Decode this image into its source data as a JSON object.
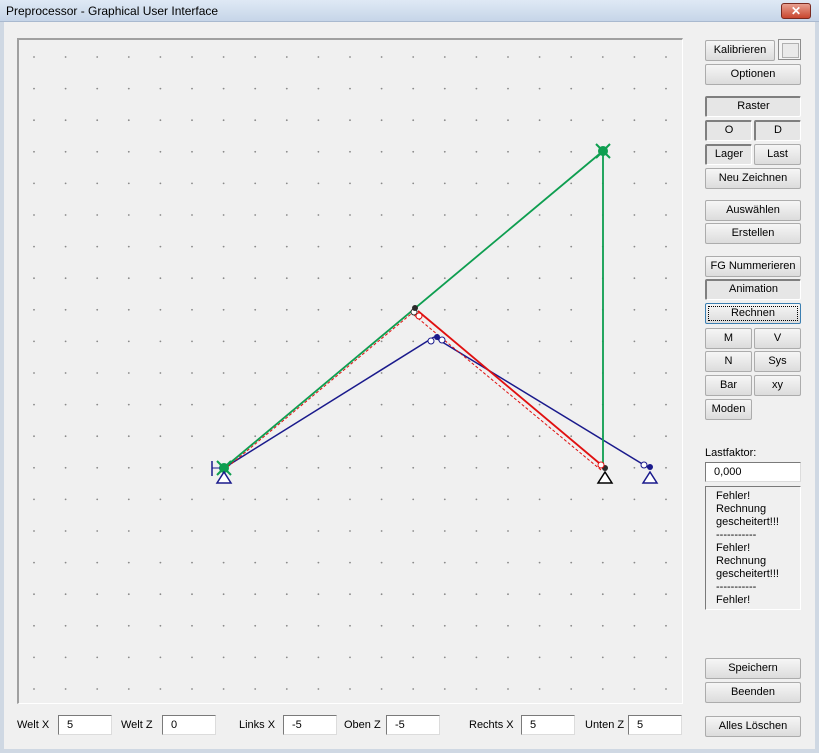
{
  "window": {
    "title": "Preprocessor - Graphical User Interface",
    "close_label": "✕"
  },
  "toolbar": {
    "kalibrieren": "Kalibrieren",
    "optionen": "Optionen",
    "raster": "Raster",
    "o": "O",
    "d": "D",
    "lager": "Lager",
    "last": "Last",
    "neu_zeichnen": "Neu Zeichnen",
    "auswaehlen": "Auswählen",
    "erstellen": "Erstellen",
    "fg_nummerieren": "FG Nummerieren",
    "animation": "Animation",
    "rechnen": "Rechnen",
    "m": "M",
    "v": "V",
    "n": "N",
    "sys": "Sys",
    "bar": "Bar",
    "xy": "xy",
    "moden": "Moden",
    "speichern": "Speichern",
    "beenden": "Beenden",
    "alles_loeschen": "Alles Löschen"
  },
  "lastfaktor": {
    "label": "Lastfaktor:",
    "value": "0,000"
  },
  "messages": [
    "Fehler!",
    "Rechnung",
    "gescheitert!!!",
    "-----------",
    "Fehler!",
    "Rechnung",
    "gescheitert!!!",
    "-----------",
    "Fehler!"
  ],
  "bottom": {
    "welt_x_label": "Welt X",
    "welt_x": "5",
    "welt_z_label": "Welt Z",
    "welt_z": "0",
    "links_x_label": "Links X",
    "links_x": "-5",
    "oben_z_label": "Oben Z",
    "oben_z": "-5",
    "rechts_x_label": "Rechts X",
    "rechts_x": "5",
    "unten_z_label": "Unten Z",
    "unten_z": "5"
  },
  "colors": {
    "green": "#0e9e50",
    "red": "#e01010",
    "blue": "#1a1a8c",
    "grid_dot": "#8a8a8a"
  }
}
